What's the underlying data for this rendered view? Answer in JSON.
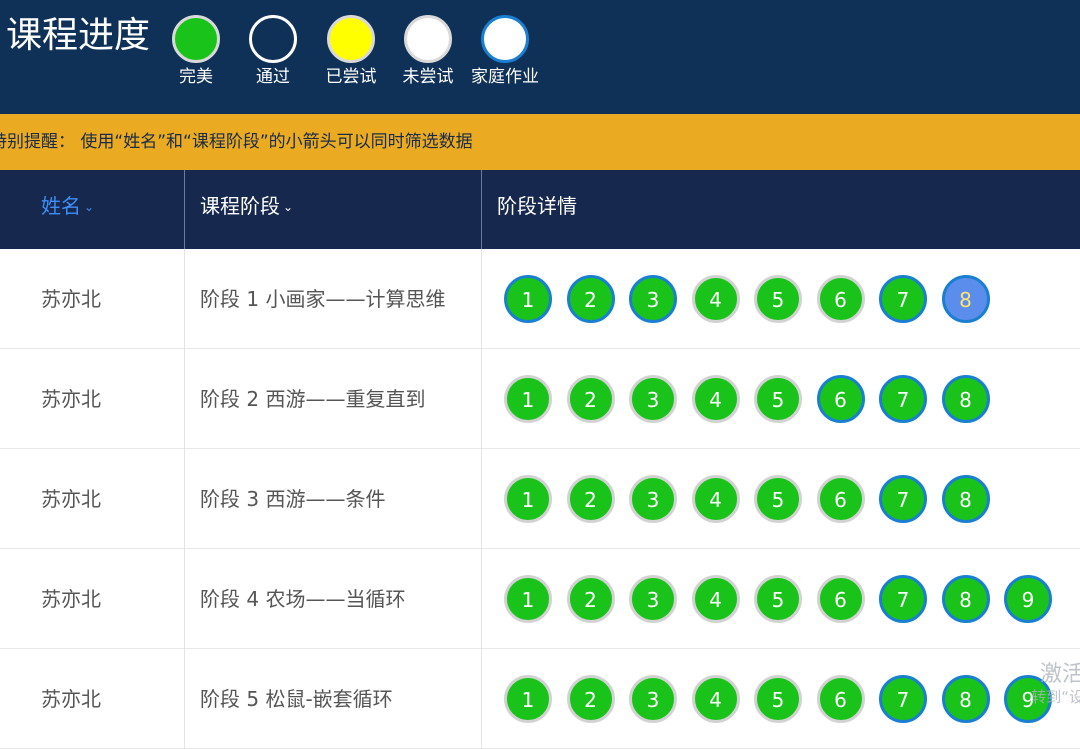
{
  "header": {
    "title": "课程进度",
    "legend": [
      {
        "label": "完美",
        "fill": "#19c31a",
        "border": "#d9d9d9"
      },
      {
        "label": "通过",
        "fill": "#0f3057",
        "border": "#ffffff"
      },
      {
        "label": "已尝试",
        "fill": "#ffff00",
        "border": "#d9d9d9"
      },
      {
        "label": "未尝试",
        "fill": "#ffffff",
        "border": "#d9d9d9"
      },
      {
        "label": "家庭作业",
        "fill": "#ffffff",
        "border": "#1a7fd0"
      }
    ]
  },
  "notice": {
    "text": "特别提醒：  使用“姓名”和“课程阶段”的小箭头可以同时筛选数据"
  },
  "table": {
    "columns": {
      "name": "姓名",
      "stage": "课程阶段",
      "detail": "阶段详情"
    },
    "rows": [
      {
        "name": "苏亦北",
        "stage": "阶段 1 小画家——计算思维",
        "lessons": [
          {
            "n": "1",
            "status": "perfect",
            "homework": true
          },
          {
            "n": "2",
            "status": "perfect",
            "homework": true
          },
          {
            "n": "3",
            "status": "perfect",
            "homework": true
          },
          {
            "n": "4",
            "status": "perfect",
            "homework": false
          },
          {
            "n": "5",
            "status": "perfect",
            "homework": false
          },
          {
            "n": "6",
            "status": "perfect",
            "homework": false
          },
          {
            "n": "7",
            "status": "perfect",
            "homework": true
          },
          {
            "n": "8",
            "status": "current",
            "homework": true
          }
        ]
      },
      {
        "name": "苏亦北",
        "stage": "阶段 2 西游——重复直到",
        "lessons": [
          {
            "n": "1",
            "status": "perfect",
            "homework": false
          },
          {
            "n": "2",
            "status": "perfect",
            "homework": false
          },
          {
            "n": "3",
            "status": "perfect",
            "homework": false
          },
          {
            "n": "4",
            "status": "perfect",
            "homework": false
          },
          {
            "n": "5",
            "status": "perfect",
            "homework": false
          },
          {
            "n": "6",
            "status": "perfect",
            "homework": true
          },
          {
            "n": "7",
            "status": "perfect",
            "homework": true
          },
          {
            "n": "8",
            "status": "perfect",
            "homework": true
          }
        ]
      },
      {
        "name": "苏亦北",
        "stage": "阶段 3 西游——条件",
        "lessons": [
          {
            "n": "1",
            "status": "perfect",
            "homework": false
          },
          {
            "n": "2",
            "status": "perfect",
            "homework": false
          },
          {
            "n": "3",
            "status": "perfect",
            "homework": false
          },
          {
            "n": "4",
            "status": "perfect",
            "homework": false
          },
          {
            "n": "5",
            "status": "perfect",
            "homework": false
          },
          {
            "n": "6",
            "status": "perfect",
            "homework": false
          },
          {
            "n": "7",
            "status": "perfect",
            "homework": true
          },
          {
            "n": "8",
            "status": "perfect",
            "homework": true
          }
        ]
      },
      {
        "name": "苏亦北",
        "stage": "阶段 4 农场——当循环",
        "lessons": [
          {
            "n": "1",
            "status": "perfect",
            "homework": false
          },
          {
            "n": "2",
            "status": "perfect",
            "homework": false
          },
          {
            "n": "3",
            "status": "perfect",
            "homework": false
          },
          {
            "n": "4",
            "status": "perfect",
            "homework": false
          },
          {
            "n": "5",
            "status": "perfect",
            "homework": false
          },
          {
            "n": "6",
            "status": "perfect",
            "homework": false
          },
          {
            "n": "7",
            "status": "perfect",
            "homework": true
          },
          {
            "n": "8",
            "status": "perfect",
            "homework": true
          },
          {
            "n": "9",
            "status": "perfect",
            "homework": true
          }
        ]
      },
      {
        "name": "苏亦北",
        "stage": "阶段 5 松鼠-嵌套循环",
        "lessons": [
          {
            "n": "1",
            "status": "perfect",
            "homework": false
          },
          {
            "n": "2",
            "status": "perfect",
            "homework": false
          },
          {
            "n": "3",
            "status": "perfect",
            "homework": false
          },
          {
            "n": "4",
            "status": "perfect",
            "homework": false
          },
          {
            "n": "5",
            "status": "perfect",
            "homework": false
          },
          {
            "n": "6",
            "status": "perfect",
            "homework": false
          },
          {
            "n": "7",
            "status": "perfect",
            "homework": true
          },
          {
            "n": "8",
            "status": "perfect",
            "homework": true
          },
          {
            "n": "9",
            "status": "perfect",
            "homework": true
          }
        ]
      }
    ]
  },
  "watermark": {
    "line1": "激活",
    "line2": "转到“设"
  }
}
